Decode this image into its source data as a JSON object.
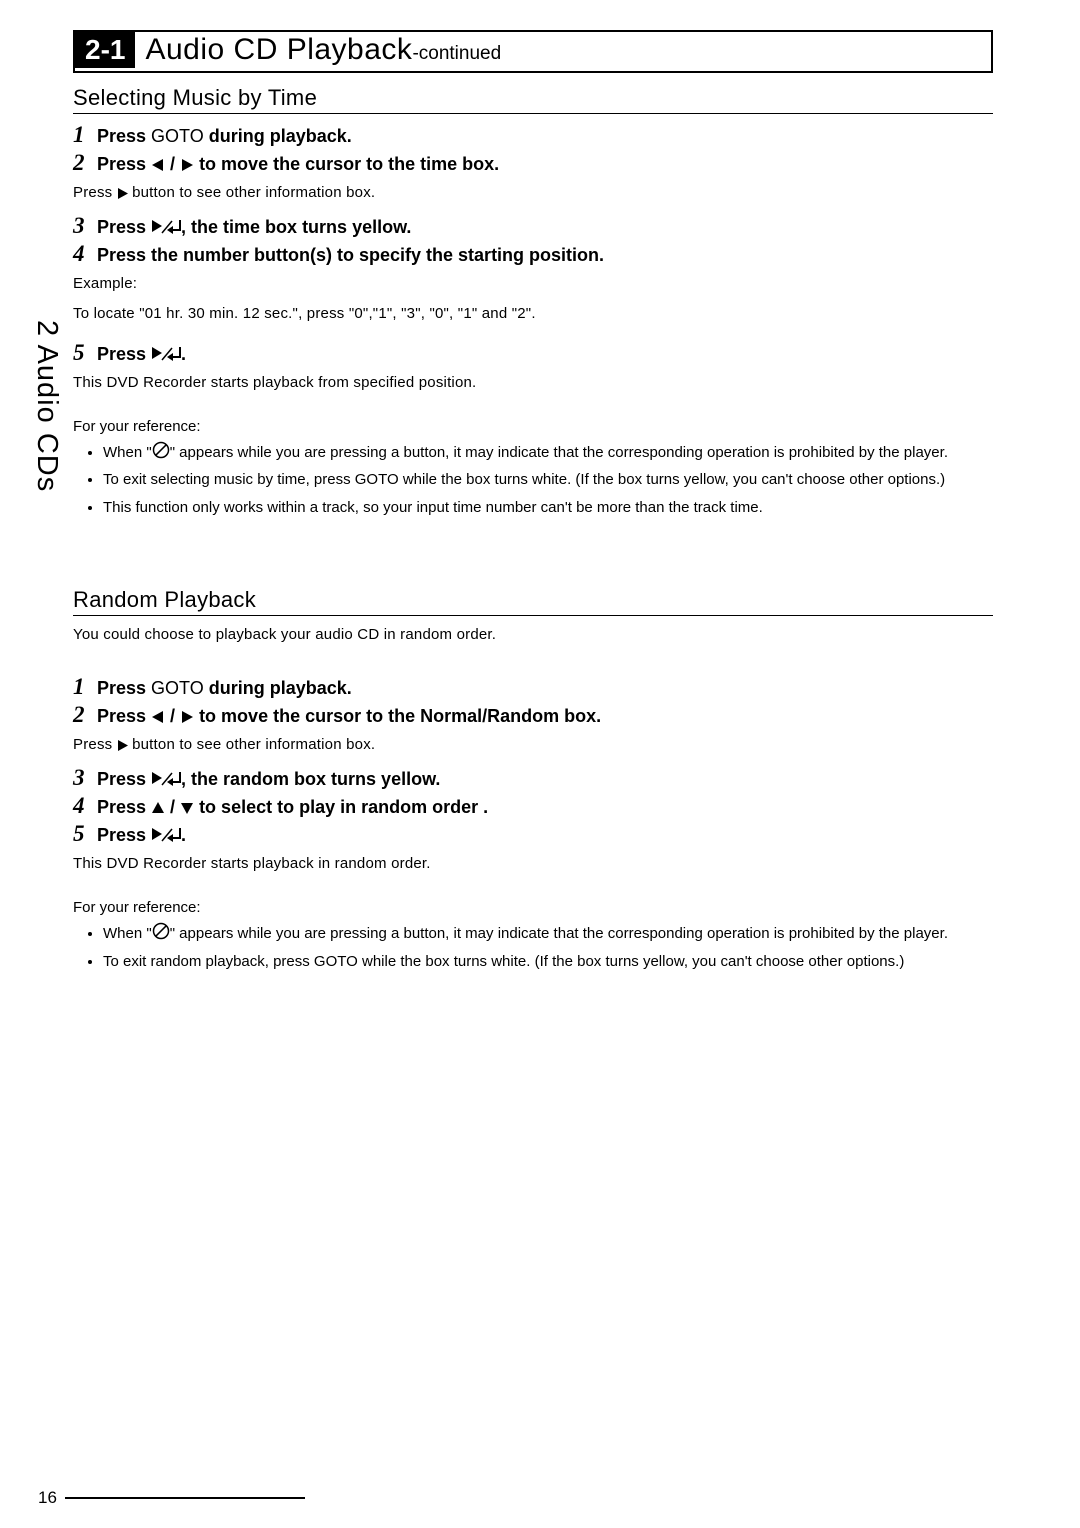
{
  "chapter": {
    "number": "2-1",
    "title_main": "Audio CD Playback",
    "title_sub": "-continued"
  },
  "sidebar_tab": "2 Audio CDs",
  "page_number": "16",
  "section1": {
    "title": "Selecting Music by Time",
    "step1": "Press GOTO during playback.",
    "step2": "Press ◀ / ▶ to move the cursor to the time box.",
    "step2_note": "Press ▶ button to see other information box.",
    "step3": "Press ▶/↵, the time box turns yellow.",
    "step4": "Press the number button(s) to specify the starting position.",
    "step4_example_label": "Example:",
    "step4_example_text": "To locate \"01 hr. 30 min. 12 sec.\", press \"0\",\"1\", \"3\", \"0\", \"1\" and \"2\".",
    "step5": "Press ▶/↵.",
    "step5_note": "This DVD Recorder starts playback from specified position.",
    "ref_title": "For your reference:",
    "ref1a": "When \"",
    "ref1b": "\" appears while you are pressing a button, it may indicate that the corresponding operation is prohibited by the player.",
    "ref2": "To exit selecting music by time, press GOTO while the box turns white. (If the box turns yellow, you can't choose other options.)",
    "ref3": "This function only works within a track, so your input time number can't be more than the track time."
  },
  "section2": {
    "title": "Random Playback",
    "intro": "You could choose to playback your audio CD in random order.",
    "step1": "Press GOTO during playback.",
    "step2": "Press ◀ / ▶ to move the cursor to the Normal/Random box.",
    "step2_note": "Press ▶ button to see other information box.",
    "step3": "Press ▶/↵, the random box turns yellow.",
    "step4": "Press ▲ / ▼ to select to play in random order .",
    "step5": "Press ▶/↵.",
    "step5_note": "This DVD Recorder starts playback in random order.",
    "ref_title": "For your reference:",
    "ref1a": "When \"",
    "ref1b": "\" appears while you are pressing a button, it may indicate that the corresponding operation is prohibited by the player.",
    "ref2": "To exit random playback, press GOTO while the box turns white. (If the box turns yellow, you can't choose other options.)"
  }
}
